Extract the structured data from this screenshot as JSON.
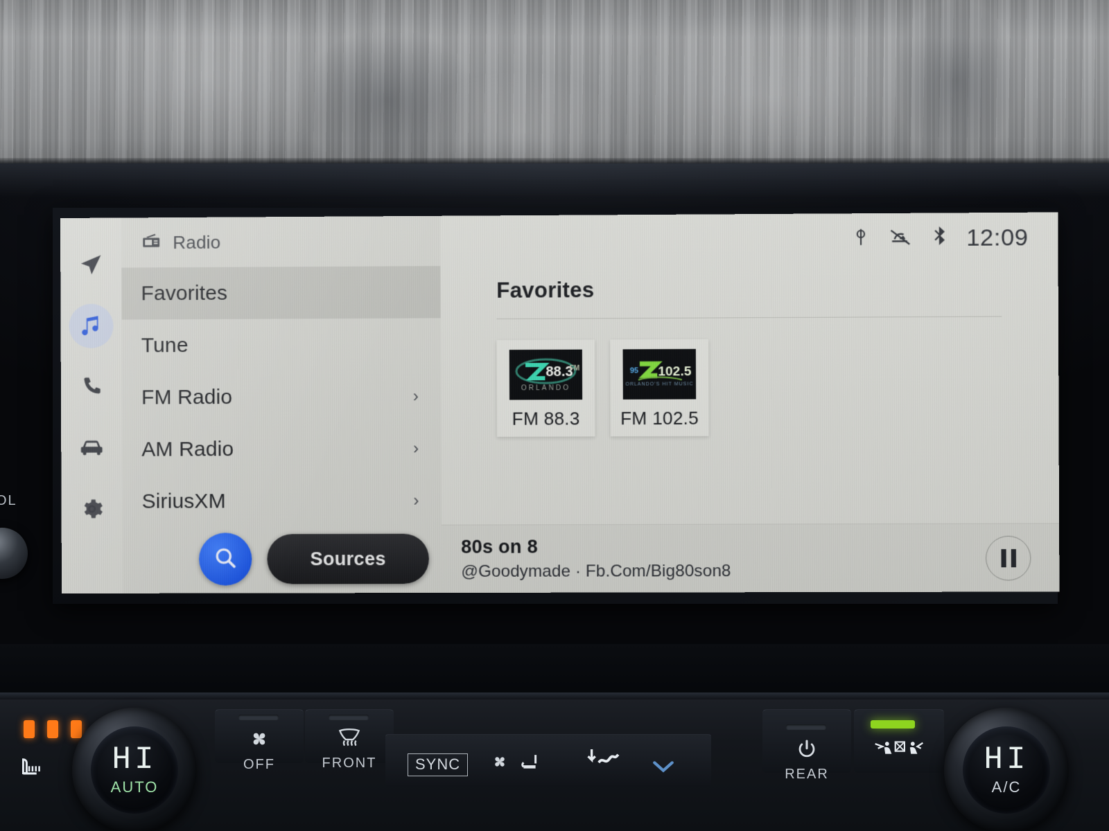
{
  "infotainment": {
    "sidebar": {
      "items": [
        {
          "name": "navigation",
          "icon": "navigation-arrow-icon",
          "active": false
        },
        {
          "name": "media",
          "icon": "music-note-icon",
          "active": true
        },
        {
          "name": "phone",
          "icon": "phone-icon",
          "active": false
        },
        {
          "name": "vehicle",
          "icon": "car-icon",
          "active": false
        },
        {
          "name": "settings",
          "icon": "gear-icon",
          "active": false
        }
      ]
    },
    "list": {
      "header": {
        "icon": "radio-icon",
        "label": "Radio"
      },
      "rows": [
        {
          "label": "Favorites",
          "selected": true,
          "chevron": ""
        },
        {
          "label": "Tune",
          "selected": false,
          "chevron": ""
        },
        {
          "label": "FM Radio",
          "selected": false,
          "chevron": "›"
        },
        {
          "label": "AM Radio",
          "selected": false,
          "chevron": "›"
        },
        {
          "label": "SiriusXM",
          "selected": false,
          "chevron": "›"
        }
      ],
      "search_icon": "search-icon",
      "sources_label": "Sources"
    },
    "statusbar": {
      "icons": [
        "wireless-charging-icon",
        "mute-notification-icon",
        "bluetooth-icon"
      ],
      "time": "12:09"
    },
    "pane": {
      "title": "Favorites",
      "tiles": [
        {
          "label": "FM 88.3",
          "logo_text": "Z 88.3",
          "logo_sub": "ORLANDO",
          "logo_accent": "#37d6b0",
          "logo_bg": "#05070a"
        },
        {
          "label": "FM 102.5",
          "logo_text": "Z 102.5",
          "logo_sub": "Orlando's Hit Music",
          "logo_accent": "#7fd93a",
          "logo_bg": "#05070a"
        }
      ]
    },
    "nowplaying": {
      "title": "80s on 8",
      "subtitle": "@Goodymade · Fb.Com/Big80son8",
      "transport_icon": "pause-icon"
    }
  },
  "climate": {
    "left_knob": {
      "value": "HI",
      "mode": "AUTO"
    },
    "right_knob": {
      "value": "HI",
      "mode": "A/C"
    },
    "seat_heater": {
      "icon": "heated-seat-icon",
      "led_count": 3
    },
    "buttons": [
      {
        "name": "fan-off",
        "icon": "fan-icon",
        "label": "OFF"
      },
      {
        "name": "front-defrost",
        "icon": "defroster-icon",
        "label": "FRONT"
      },
      {
        "name": "rear-defrost",
        "icon": "power-icon",
        "label": "REAR"
      },
      {
        "name": "airflow-mode",
        "icon": "airflow-icon",
        "label": ""
      }
    ],
    "sync_label": "SYNC",
    "volume_label": "OL"
  }
}
